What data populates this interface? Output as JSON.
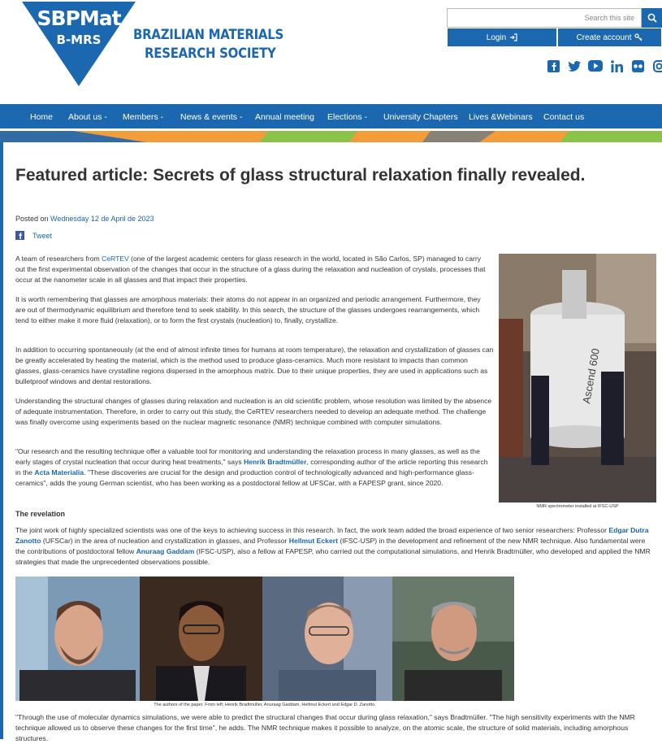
{
  "header": {
    "logo_main": "SBPMat",
    "logo_sub": "B-MRS",
    "society_line1": "BRAZILIAN MATERIALS",
    "society_line2": "RESEARCH SOCIETY",
    "search_placeholder": "Search this site",
    "login_label": "Login",
    "create_account_label": "Create account",
    "social": [
      "facebook-icon",
      "twitter-icon",
      "youtube-icon",
      "linkedin-icon",
      "flickr-icon",
      "instagram-icon"
    ]
  },
  "nav": {
    "items": [
      "Home",
      "About us -",
      "Members -",
      "News & events -",
      "Annual meeting",
      "Elections -",
      "University Chapters",
      "Lives &Webinars",
      "Contact us"
    ]
  },
  "article": {
    "title": "Featured article: Secrets of glass structural relaxation finally revealed.",
    "posted_prefix": "Posted on",
    "posted_date": "Wednesday 12 de April de 2023",
    "tweet_label": "Tweet",
    "p1_a": "A team of researchers from ",
    "p1_link": "CeRTEV",
    "p1_b": " (one of the largest academic centers for glass research in the world, located in São Carlos, SP) managed to carry out the first experimental observation of the changes that occur in the structure of a glass during the relaxation and nucleation of crystals, processes that occur at the nanometer scale in all glasses and that impact their properties.",
    "p2": "It is worth remembering that glasses are amorphous materials: their atoms do not appear in an organized and periodic arrangement. Furthermore, they are out of thermodynamic equilibrium and therefore tend to seek stability. In this search, the structure of the glasses undergoes rearrangements, which tend to either make it more fluid (relaxation), or to form the first crystals (nucleation) to, finally, crystallize.",
    "p3": "In addition to occurring spontaneously (at the end of almost infinite times for humans at room temperature), the relaxation and crystallization of glasses can be greatly accelerated by heating the material, which is the method used to produce glass-ceramics. Much more resistant to impacts than common glasses, glass-ceramics have crystalline regions dispersed in the amorphous matrix. Due to their unique properties, they are used in applications such as bulletproof windows and dental restorations.",
    "p4": "Understanding the structural changes of glasses during relaxation and nucleation is an old scientific problem, whose resolution was limited by the absence of adequate instrumentation. Therefore, in order to carry out this study, the CeRTEV researchers needed to develop an adequate method. The challenge was finally overcome using experiments based on the nuclear magnetic resonance (NMR) technique combined with computer simulations.",
    "p5_a": "\"Our research and the resulting technique offer a valuable tool for monitoring and understanding the relaxation process in many glasses, as well as the early stages of crystal nucleation that occur during heat treatments,\" says ",
    "p5_link1": "Henrik Bradtmüller",
    "p5_b": ", corresponding author of the article reporting this research in the ",
    "p5_link2": "Acta Materialia",
    "p5_c": ". \"These discoveries are crucial for the design and production control of technologically advanced and high-performance glass-ceramics\", adds the young German scientist, who has been working as a postdoctoral fellow at UFSCar, with a FAPESP grant, since 2020.",
    "revelation_heading": "The revelation",
    "p6_a": "The joint work of highly specialized scientists was one of the keys to achieving success in this research. In fact, the work team added the broad experience of two senior researchers: Professor ",
    "p6_link1": "Edgar Dutra Zanotto",
    "p6_b": " (UFSCar) in the area of nucleation and crystallization in glasses, and Professor ",
    "p6_link2": "Hellmut Eckert",
    "p6_c": " (IFSC-USP) in the development and refinement of the new NMR technique. Also fundamental were the contributions of postdoctoral fellow ",
    "p6_link3": "Anuraag Gaddam",
    "p6_d": " (IFSC-USP), also a fellow at FAPESP, who carried out the computational simulations, and Henrik Bradtmüller, who developed and applied the NMR strategies that made the unprecedented observations possible.",
    "nmr_label": "Ascend 600",
    "nmr_caption": "NMR spectrometer installed at IFSC-USP",
    "photos_caption": "The authors of the paper. From left: Henrik Bradtmüller, Anuraag Gaddam, Hellmut Eckert and Edgar D. Zanotto.",
    "p7": "\"Through the use of molecular dynamics simulations, we were able to predict the structural changes that occur during glass relaxation,\" says Bradtmüller. \"The high sensitivity experiments with the NMR technique allowed us to observe these changes for the first time\", he adds. The NMR technique makes it possible to analyze, on the atomic scale, the structure of solid materials, including amorphous structures."
  },
  "colors": {
    "brand_blue": "#1c68b0",
    "link_blue": "#1a66b0",
    "stripe_orange": "#f39c3a",
    "stripe_green": "#8bc34a"
  }
}
